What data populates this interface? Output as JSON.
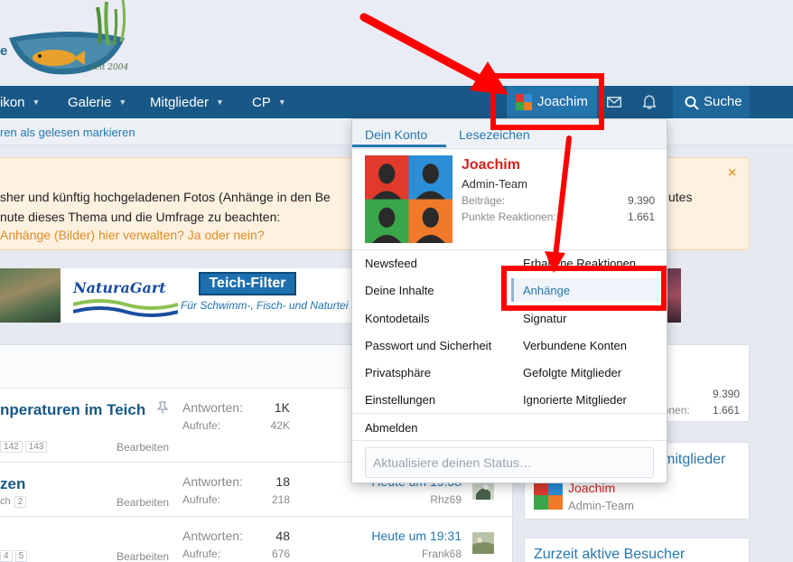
{
  "logo": {
    "tagline": "seit 2004",
    "partial_letter": "e"
  },
  "nav": {
    "items": [
      {
        "label": "ikon",
        "caret": "▼"
      },
      {
        "label": "Galerie",
        "caret": "▼"
      },
      {
        "label": "Mitglieder",
        "caret": "▼"
      },
      {
        "label": "CP",
        "caret": "▼"
      }
    ],
    "user_label": "Joachim",
    "search_label": "Suche",
    "icons": [
      "envelope-icon",
      "bell-icon",
      "search-icon"
    ]
  },
  "subnav": {
    "link": "ren als gelesen markieren"
  },
  "notice": {
    "line1": "sher und künftig hochgeladenen Fotos (Anhänge in den Be",
    "line1_right": "utes",
    "line2": "nute dieses Thema und die Umfrage zu beachten:",
    "line3": "Anhänge (Bilder) hier verwalten? Ja oder nein?",
    "close": "×"
  },
  "banner": {
    "naturagart": "NaturaGart",
    "teichfilter_title": "Teich-Filter",
    "teichfilter_sub": "Für Schwimm-, Fisch- und Naturtei"
  },
  "threads": [
    {
      "title": "nperaturen im Teich",
      "pages": [
        "142",
        "143"
      ],
      "edit": "Bearbeiten",
      "replies_label": "Antworten:",
      "replies": "1K",
      "views_label": "Aufrufe:",
      "views": "42K",
      "last_time": "",
      "last_user": ""
    },
    {
      "title": "zen",
      "pages_prefix": "ch",
      "pages": [
        "2"
      ],
      "edit": "Bearbeiten",
      "replies_label": "Antworten:",
      "replies": "18",
      "views_label": "Aufrufe:",
      "views": "218",
      "last_time": "Heute um 19:38",
      "last_user": "Rhz69"
    },
    {
      "title": "",
      "pages": [
        "4",
        "5"
      ],
      "edit": "Bearbeiten",
      "replies_label": "Antworten:",
      "replies": "48",
      "views_label": "Aufrufe:",
      "views": "676",
      "last_time": "Heute um 19:31",
      "last_user": "Frank68"
    }
  ],
  "sidebar": {
    "stats_value1": "9.390",
    "stats_label2": "ionen:",
    "stats_value2": "1.661",
    "online_title": "mitglieder",
    "online_user": "Joachim",
    "online_role": "Admin-Team",
    "visitors_title": "Zurzeit aktive Besucher"
  },
  "dropdown": {
    "tabs": [
      "Dein Konto",
      "Lesezeichen"
    ],
    "name": "Joachim",
    "role": "Admin-Team",
    "stats": [
      {
        "label": "Beiträge:",
        "value": "9.390"
      },
      {
        "label": "Punkte Reaktionen:",
        "value": "1.661"
      }
    ],
    "links_left": [
      "Newsfeed",
      "Deine Inhalte",
      "Kontodetails",
      "Passwort und Sicherheit",
      "Privatsphäre",
      "Einstellungen"
    ],
    "links_right": [
      "Erhaltene Reaktionen",
      "Anhänge",
      "Signatur",
      "Verbundene Konten",
      "Gefolgte Mitglieder",
      "Ignorierte Mitglieder"
    ],
    "logout": "Abmelden",
    "status_placeholder": "Aktualisiere deinen Status…"
  },
  "colors": {
    "nav": "#185886",
    "accent": "#2577b1",
    "name_red": "#d42121",
    "annotation": "#ff0000"
  }
}
